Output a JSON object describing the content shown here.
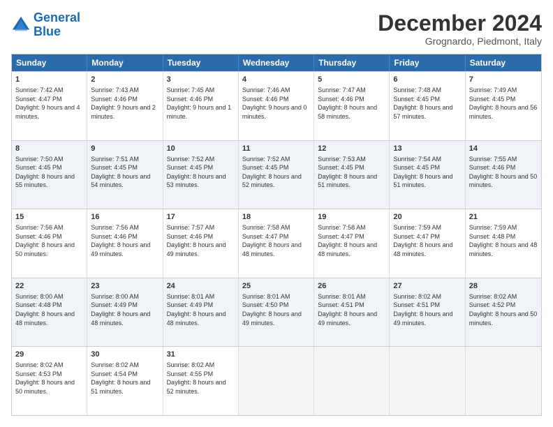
{
  "header": {
    "logo_line1": "General",
    "logo_line2": "Blue",
    "month_title": "December 2024",
    "subtitle": "Grognardo, Piedmont, Italy"
  },
  "days_of_week": [
    "Sunday",
    "Monday",
    "Tuesday",
    "Wednesday",
    "Thursday",
    "Friday",
    "Saturday"
  ],
  "weeks": [
    [
      {
        "day": "1",
        "sunrise": "Sunrise: 7:42 AM",
        "sunset": "Sunset: 4:47 PM",
        "daylight": "Daylight: 9 hours and 4 minutes."
      },
      {
        "day": "2",
        "sunrise": "Sunrise: 7:43 AM",
        "sunset": "Sunset: 4:46 PM",
        "daylight": "Daylight: 9 hours and 2 minutes."
      },
      {
        "day": "3",
        "sunrise": "Sunrise: 7:45 AM",
        "sunset": "Sunset: 4:46 PM",
        "daylight": "Daylight: 9 hours and 1 minute."
      },
      {
        "day": "4",
        "sunrise": "Sunrise: 7:46 AM",
        "sunset": "Sunset: 4:46 PM",
        "daylight": "Daylight: 9 hours and 0 minutes."
      },
      {
        "day": "5",
        "sunrise": "Sunrise: 7:47 AM",
        "sunset": "Sunset: 4:46 PM",
        "daylight": "Daylight: 8 hours and 58 minutes."
      },
      {
        "day": "6",
        "sunrise": "Sunrise: 7:48 AM",
        "sunset": "Sunset: 4:45 PM",
        "daylight": "Daylight: 8 hours and 57 minutes."
      },
      {
        "day": "7",
        "sunrise": "Sunrise: 7:49 AM",
        "sunset": "Sunset: 4:45 PM",
        "daylight": "Daylight: 8 hours and 56 minutes."
      }
    ],
    [
      {
        "day": "8",
        "sunrise": "Sunrise: 7:50 AM",
        "sunset": "Sunset: 4:45 PM",
        "daylight": "Daylight: 8 hours and 55 minutes."
      },
      {
        "day": "9",
        "sunrise": "Sunrise: 7:51 AM",
        "sunset": "Sunset: 4:45 PM",
        "daylight": "Daylight: 8 hours and 54 minutes."
      },
      {
        "day": "10",
        "sunrise": "Sunrise: 7:52 AM",
        "sunset": "Sunset: 4:45 PM",
        "daylight": "Daylight: 8 hours and 53 minutes."
      },
      {
        "day": "11",
        "sunrise": "Sunrise: 7:52 AM",
        "sunset": "Sunset: 4:45 PM",
        "daylight": "Daylight: 8 hours and 52 minutes."
      },
      {
        "day": "12",
        "sunrise": "Sunrise: 7:53 AM",
        "sunset": "Sunset: 4:45 PM",
        "daylight": "Daylight: 8 hours and 51 minutes."
      },
      {
        "day": "13",
        "sunrise": "Sunrise: 7:54 AM",
        "sunset": "Sunset: 4:45 PM",
        "daylight": "Daylight: 8 hours and 51 minutes."
      },
      {
        "day": "14",
        "sunrise": "Sunrise: 7:55 AM",
        "sunset": "Sunset: 4:46 PM",
        "daylight": "Daylight: 8 hours and 50 minutes."
      }
    ],
    [
      {
        "day": "15",
        "sunrise": "Sunrise: 7:56 AM",
        "sunset": "Sunset: 4:46 PM",
        "daylight": "Daylight: 8 hours and 50 minutes."
      },
      {
        "day": "16",
        "sunrise": "Sunrise: 7:56 AM",
        "sunset": "Sunset: 4:46 PM",
        "daylight": "Daylight: 8 hours and 49 minutes."
      },
      {
        "day": "17",
        "sunrise": "Sunrise: 7:57 AM",
        "sunset": "Sunset: 4:46 PM",
        "daylight": "Daylight: 8 hours and 49 minutes."
      },
      {
        "day": "18",
        "sunrise": "Sunrise: 7:58 AM",
        "sunset": "Sunset: 4:47 PM",
        "daylight": "Daylight: 8 hours and 48 minutes."
      },
      {
        "day": "19",
        "sunrise": "Sunrise: 7:58 AM",
        "sunset": "Sunset: 4:47 PM",
        "daylight": "Daylight: 8 hours and 48 minutes."
      },
      {
        "day": "20",
        "sunrise": "Sunrise: 7:59 AM",
        "sunset": "Sunset: 4:47 PM",
        "daylight": "Daylight: 8 hours and 48 minutes."
      },
      {
        "day": "21",
        "sunrise": "Sunrise: 7:59 AM",
        "sunset": "Sunset: 4:48 PM",
        "daylight": "Daylight: 8 hours and 48 minutes."
      }
    ],
    [
      {
        "day": "22",
        "sunrise": "Sunrise: 8:00 AM",
        "sunset": "Sunset: 4:48 PM",
        "daylight": "Daylight: 8 hours and 48 minutes."
      },
      {
        "day": "23",
        "sunrise": "Sunrise: 8:00 AM",
        "sunset": "Sunset: 4:49 PM",
        "daylight": "Daylight: 8 hours and 48 minutes."
      },
      {
        "day": "24",
        "sunrise": "Sunrise: 8:01 AM",
        "sunset": "Sunset: 4:49 PM",
        "daylight": "Daylight: 8 hours and 48 minutes."
      },
      {
        "day": "25",
        "sunrise": "Sunrise: 8:01 AM",
        "sunset": "Sunset: 4:50 PM",
        "daylight": "Daylight: 8 hours and 49 minutes."
      },
      {
        "day": "26",
        "sunrise": "Sunrise: 8:01 AM",
        "sunset": "Sunset: 4:51 PM",
        "daylight": "Daylight: 8 hours and 49 minutes."
      },
      {
        "day": "27",
        "sunrise": "Sunrise: 8:02 AM",
        "sunset": "Sunset: 4:51 PM",
        "daylight": "Daylight: 8 hours and 49 minutes."
      },
      {
        "day": "28",
        "sunrise": "Sunrise: 8:02 AM",
        "sunset": "Sunset: 4:52 PM",
        "daylight": "Daylight: 8 hours and 50 minutes."
      }
    ],
    [
      {
        "day": "29",
        "sunrise": "Sunrise: 8:02 AM",
        "sunset": "Sunset: 4:53 PM",
        "daylight": "Daylight: 8 hours and 50 minutes."
      },
      {
        "day": "30",
        "sunrise": "Sunrise: 8:02 AM",
        "sunset": "Sunset: 4:54 PM",
        "daylight": "Daylight: 8 hours and 51 minutes."
      },
      {
        "day": "31",
        "sunrise": "Sunrise: 8:02 AM",
        "sunset": "Sunset: 4:55 PM",
        "daylight": "Daylight: 8 hours and 52 minutes."
      },
      null,
      null,
      null,
      null
    ]
  ]
}
